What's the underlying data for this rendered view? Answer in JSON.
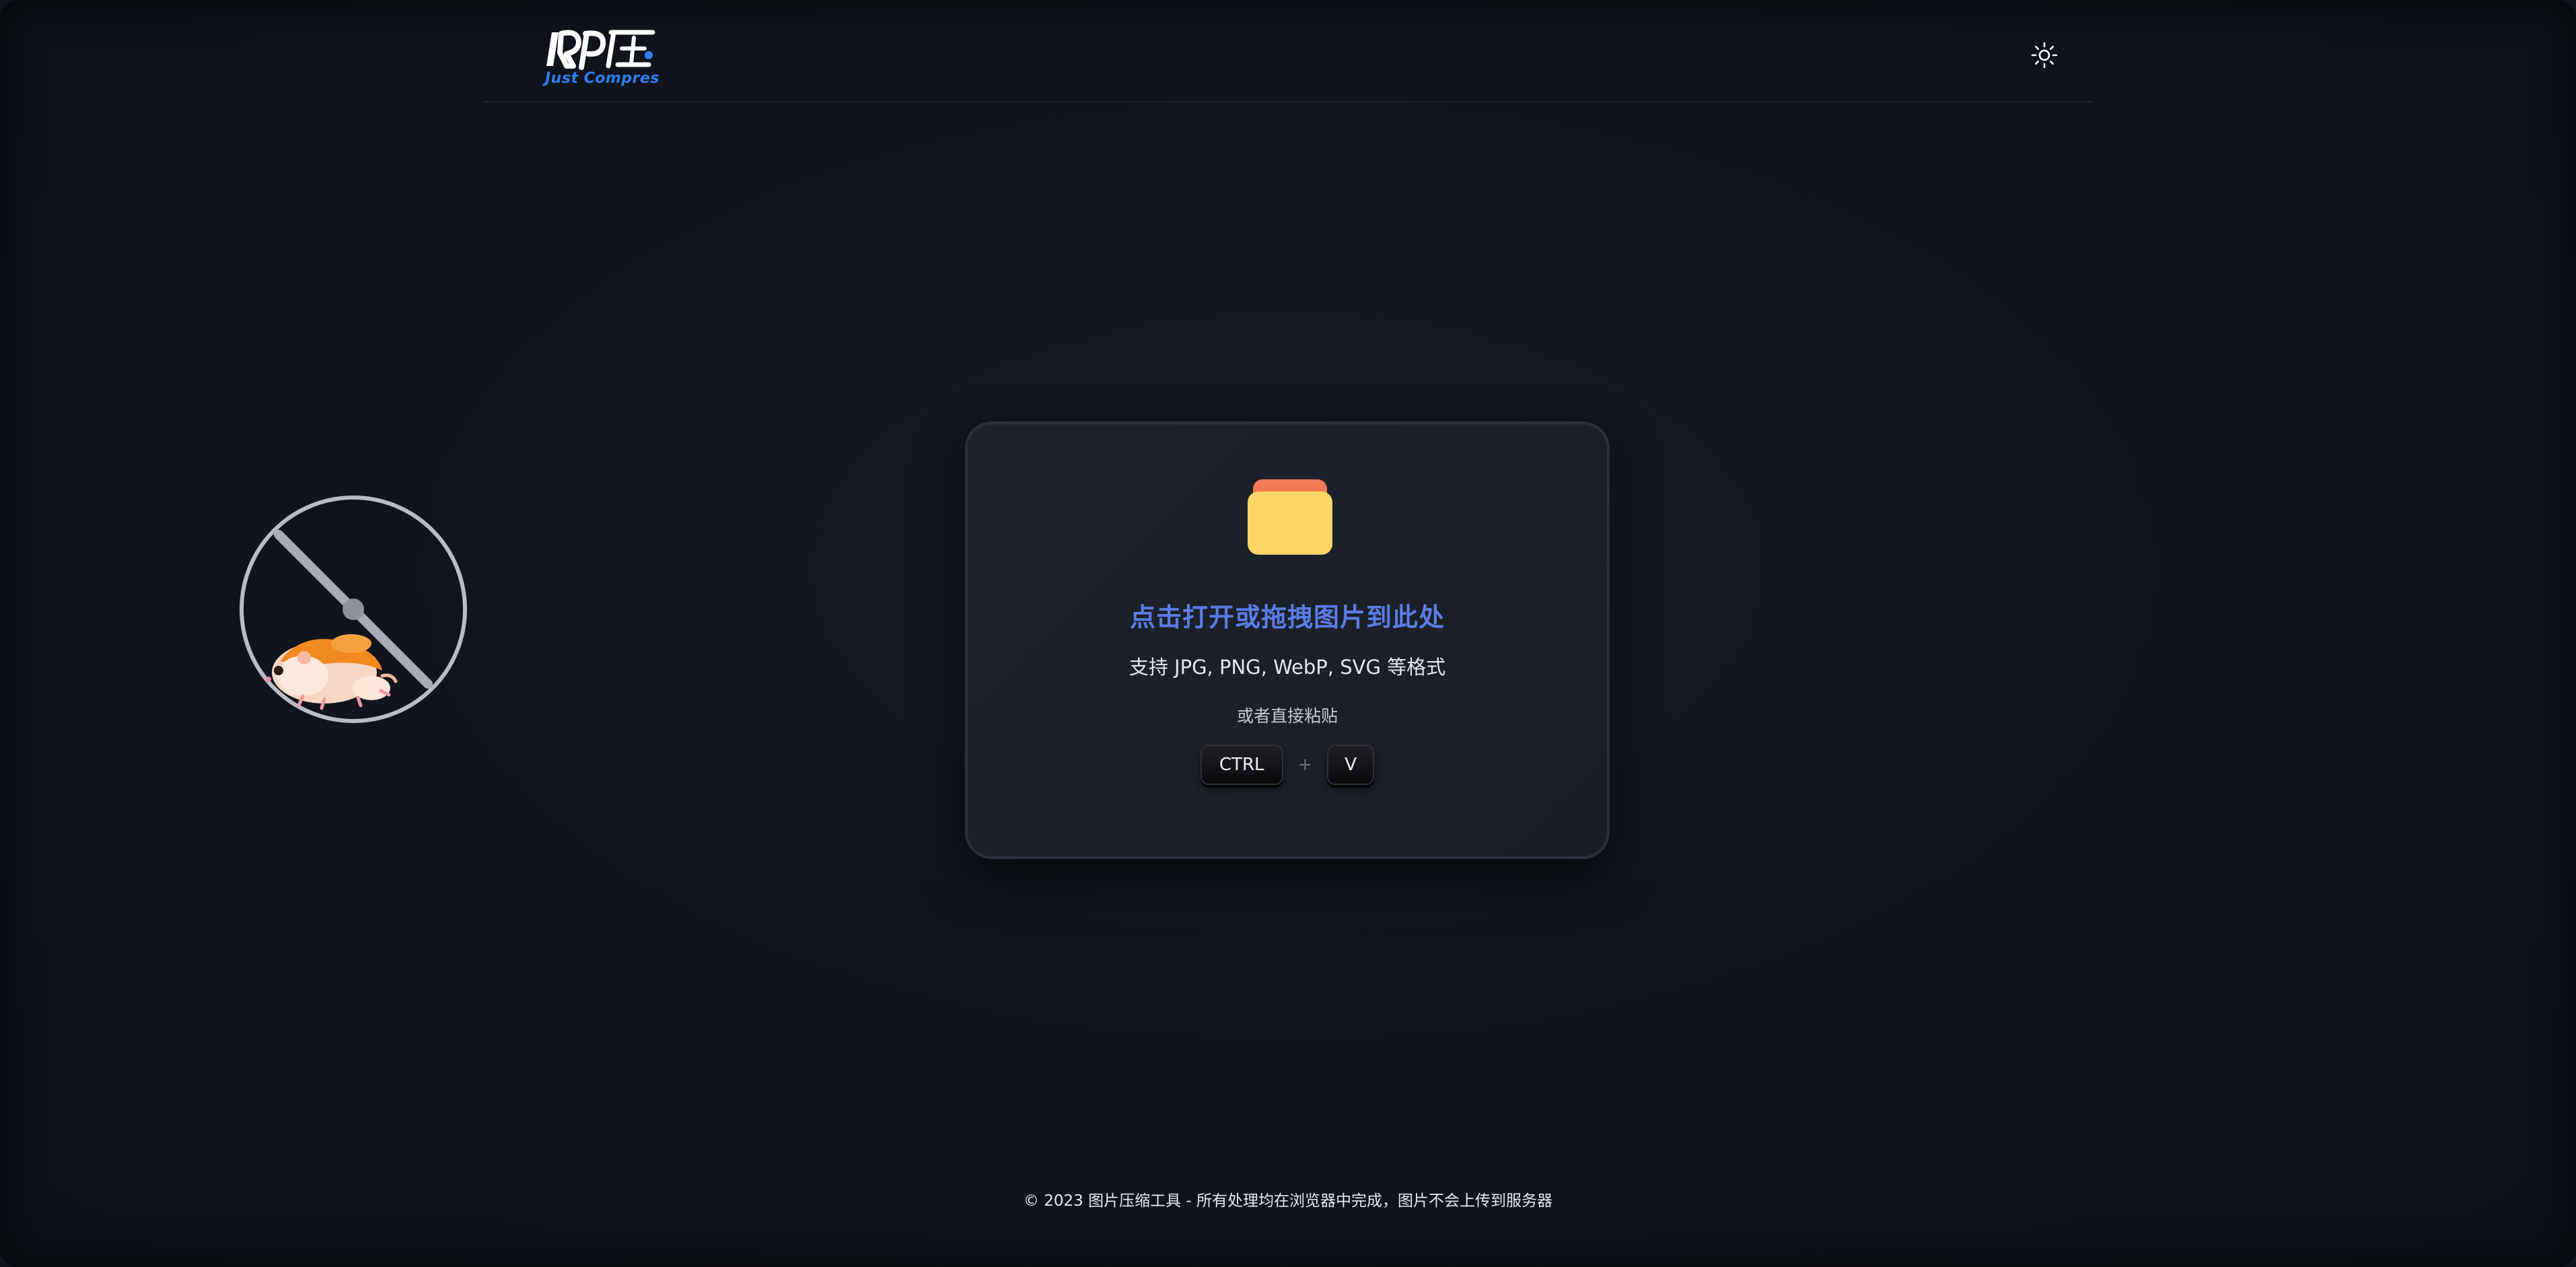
{
  "header": {
    "logo_sub": "Just Compres",
    "theme_toggle_icon": "sun-icon"
  },
  "upload": {
    "icon": "folder-icon",
    "title": "点击打开或拖拽图片到此处",
    "formats": "支持 JPG, PNG, WebP, SVG 等格式",
    "paste_hint": "或者直接粘贴",
    "key_ctrl": "CTRL",
    "key_plus": "+",
    "key_v": "V"
  },
  "footer": {
    "text": "© 2023 图片压缩工具 - 所有处理均在浏览器中完成，图片不会上传到服务器"
  },
  "colors": {
    "background": "#10141c",
    "accent": "#5b7de8",
    "logo_blue": "#2f7ff2",
    "folder_front": "#fdd668",
    "folder_back": "#f47a55"
  }
}
